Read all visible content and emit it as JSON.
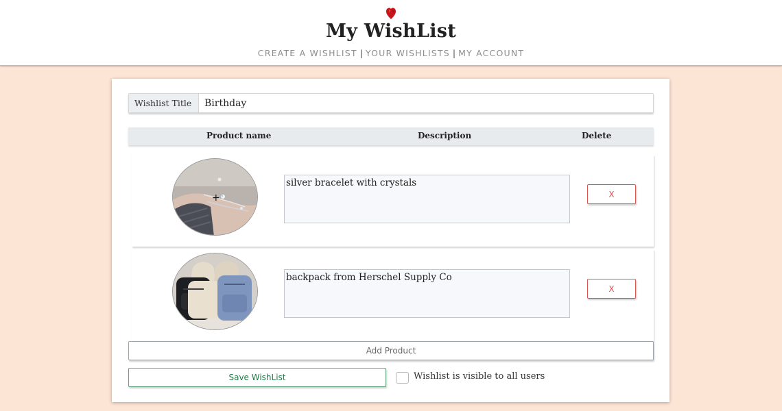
{
  "header": {
    "logo_icon": "red-heart-gem-icon",
    "title": "My WishList",
    "nav": {
      "create": "CREATE A WISHLIST",
      "yours": "YOUR WISHLISTS",
      "account": "MY ACCOUNT",
      "separator": "|"
    }
  },
  "form": {
    "title_label": "Wishlist Title",
    "title_value": "Birthday",
    "columns": {
      "name": "Product name",
      "description": "Description",
      "delete": "Delete"
    },
    "products": [
      {
        "image": "silver-bracelet-photo",
        "description": "silver bracelet with crystals",
        "delete_label": "X"
      },
      {
        "image": "backpacks-photo",
        "description": "backpack from Herschel Supply Co",
        "delete_label": "X"
      }
    ],
    "add_label": "Add Product",
    "save_label": "Save WishList",
    "visibility_label": "Wishlist is visible to all users",
    "visibility_checked": false
  },
  "colors": {
    "background": "#fde5d6",
    "delete": "#d9534f",
    "save": "#1f7a45"
  }
}
